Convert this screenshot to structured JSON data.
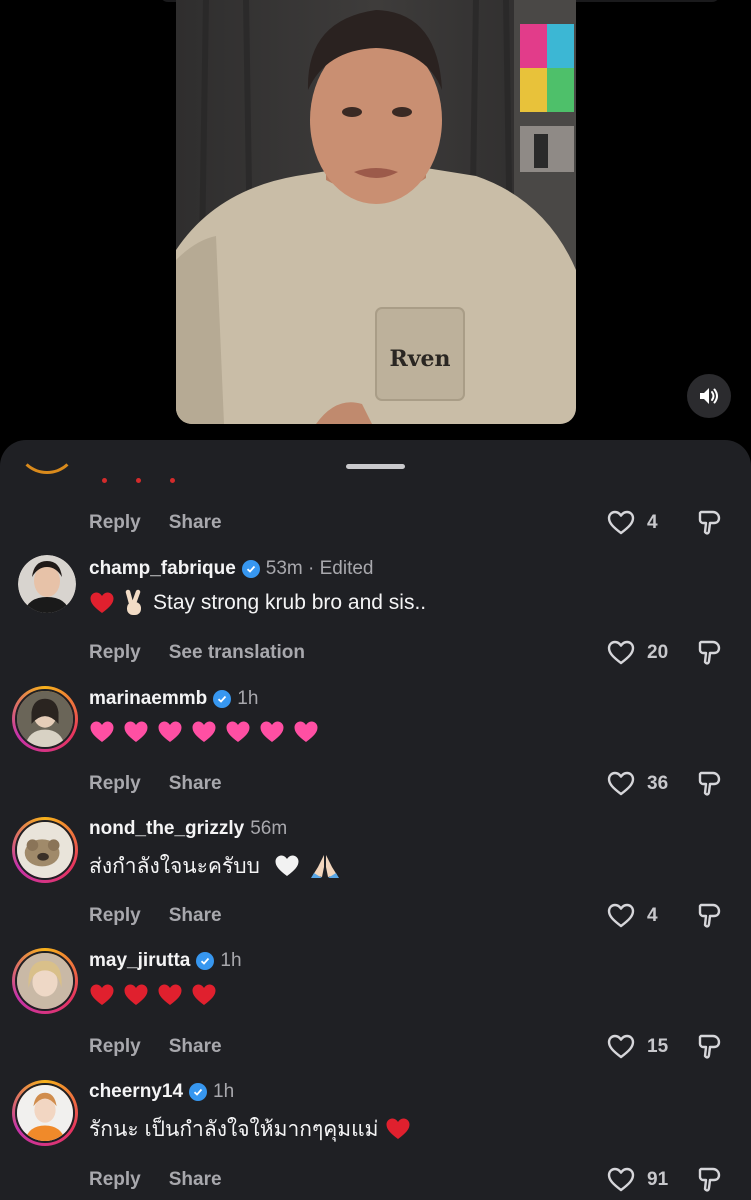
{
  "colors": {
    "sheet_bg": "#1f2024",
    "verified_blue": "#3797f0",
    "red_heart": "#e0202e",
    "pink_heart": "#ff4fa3",
    "white_heart": "#f2f2f2",
    "story_ring_start": "#f7b21a",
    "story_ring_end": "#c533a8"
  },
  "video": {
    "mute_icon": "speaker-icon"
  },
  "partial_comment": {
    "reply_label": "Reply",
    "share_label": "Share",
    "like_count": "4"
  },
  "comments": [
    {
      "username": "champ_fabrique",
      "verified": true,
      "time": "53m · Edited",
      "emojis": [
        "red-heart",
        "victory-hand"
      ],
      "text": "Stay strong krub bro and sis..",
      "reply_label": "Reply",
      "second_action": "See translation",
      "like_count": "20"
    },
    {
      "username": "marinaemmb",
      "verified": true,
      "time": "1h",
      "emojis": [
        "pink-heart",
        "pink-heart",
        "pink-heart",
        "pink-heart",
        "pink-heart",
        "pink-heart",
        "pink-heart"
      ],
      "text": "",
      "reply_label": "Reply",
      "second_action": "Share",
      "like_count": "36"
    },
    {
      "username": "nond_the_grizzly",
      "verified": false,
      "time": "56m",
      "text": "ส่งกำลังใจนะครับบ",
      "emojis_after": [
        "white-heart",
        "folded-hands"
      ],
      "reply_label": "Reply",
      "second_action": "Share",
      "like_count": "4"
    },
    {
      "username": "may_jirutta",
      "verified": true,
      "time": "1h",
      "emojis": [
        "red-heart",
        "red-heart",
        "red-heart",
        "red-heart"
      ],
      "text": "",
      "reply_label": "Reply",
      "second_action": "Share",
      "like_count": "15"
    },
    {
      "username": "cheerny14",
      "verified": true,
      "time": "1h",
      "text": "รักนะ เป็นกำลังใจให้มากๆคุมแม่",
      "emojis_after": [
        "red-heart"
      ],
      "reply_label": "Reply",
      "second_action": "Share",
      "like_count": "91"
    }
  ]
}
